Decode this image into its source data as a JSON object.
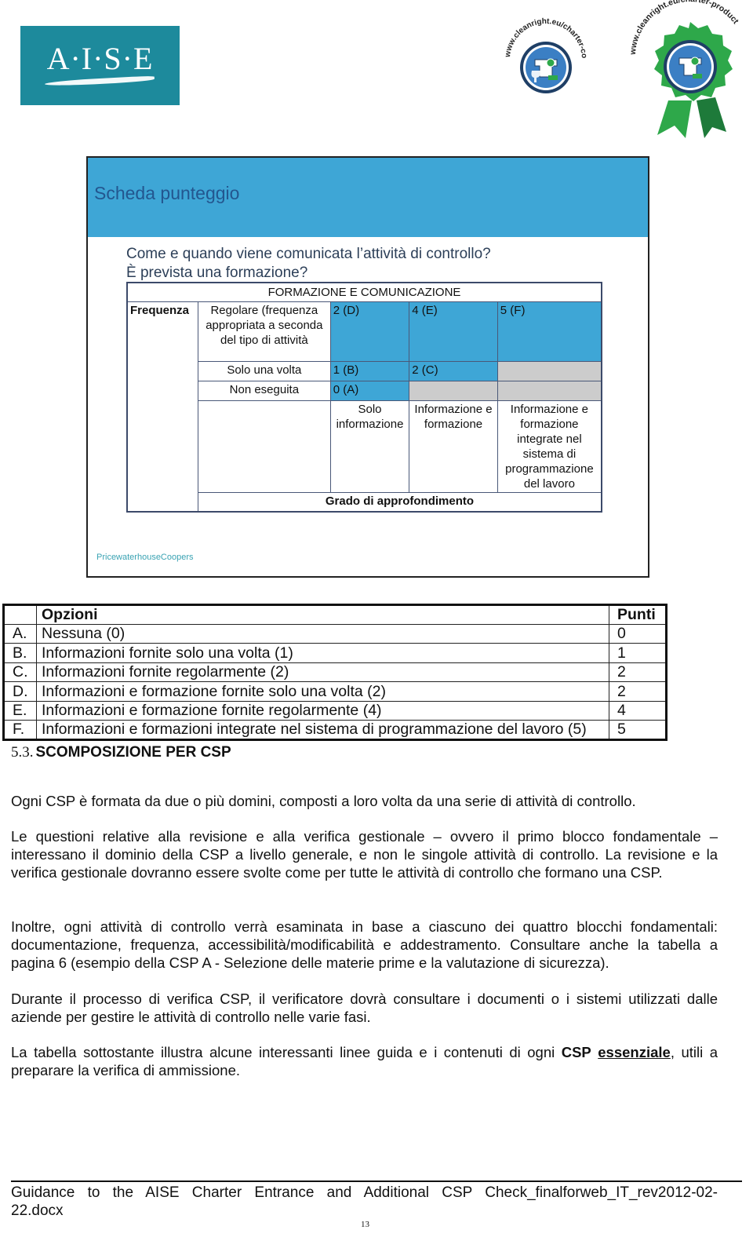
{
  "header": {
    "logo_text": "A·I·S·E",
    "badge_company_url": "www.cleanright.eu/charter-company",
    "badge_product_url": "www.cleanright.eu/charter-product",
    "colors": {
      "aise_teal": "#1d8a9c",
      "badge_blue": "#3b7fc4",
      "badge_green": "#2ea84a"
    }
  },
  "slide": {
    "title": "Scheda punteggio",
    "question_line1": "Come e quando viene comunicata l’attività di controllo?",
    "question_line2": "È prevista una formazione?",
    "footer": "PricewaterhouseCoopers",
    "colors": {
      "header_blue": "#3ea6d6",
      "cell_blue": "#3ea6d6",
      "cell_grey": "#cccccc"
    },
    "matrix": {
      "title": "FORMAZIONE E COMUNICAZIONE",
      "row_axis_label": "Frequenza",
      "rows": [
        {
          "label": "Regolare (frequenza appropriata a seconda del tipo di attività",
          "cells": [
            "2 (D)",
            "4 (E)",
            "5 (F)"
          ]
        },
        {
          "label": "Solo una volta",
          "cells": [
            "1 (B)",
            "2 (C)",
            ""
          ]
        },
        {
          "label": "Non eseguita",
          "cells": [
            "0 (A)",
            "",
            ""
          ]
        }
      ],
      "column_headers": [
        "Solo informazione",
        "Informazione e formazione",
        "Informazione e formazione integrate nel sistema di programmazione del lavoro"
      ],
      "column_axis_label": "Grado di approfondimento"
    }
  },
  "options_table": {
    "header_option": "Opzioni",
    "header_points": "Punti",
    "rows": [
      {
        "letter": "A.",
        "text": "Nessuna (0)",
        "points": "0"
      },
      {
        "letter": "B.",
        "text": "Informazioni fornite solo una volta (1)",
        "points": "1"
      },
      {
        "letter": "C.",
        "text": "Informazioni fornite regolarmente (2)",
        "points": "2"
      },
      {
        "letter": "D.",
        "text": "Informazioni e formazione fornite solo una volta (2)",
        "points": "2"
      },
      {
        "letter": "E.",
        "text": "Informazioni e formazione fornite regolarmente (4)",
        "points": "4"
      },
      {
        "letter": "F.",
        "text": "Informazioni e formazioni integrate nel sistema di programmazione del lavoro (5)",
        "points": "5"
      }
    ]
  },
  "section": {
    "number": "5.3.",
    "title": "SCOMPOSIZIONE PER CSP"
  },
  "paragraphs": {
    "p1": "Ogni CSP è formata da due o più domini, composti a loro volta da una serie di attività di controllo.",
    "p2": "Le questioni relative alla revisione e alla verifica gestionale – ovvero il primo blocco fondamentale – interessano il dominio della CSP a livello generale, e non le singole attività di controllo. La revisione e la verifica gestionale dovranno essere svolte come per tutte le attività di controllo che formano una CSP.",
    "p3": "Inoltre, ogni attività di controllo verrà esaminata in base a ciascuno dei quattro blocchi fondamentali: documentazione, frequenza, accessibilità/modificabilità e addestramento. Consultare anche la tabella a pagina 6 (esempio della CSP A - Selezione delle materie prime e la valutazione di sicurezza).",
    "p4": "Durante il processo di verifica CSP, il verificatore dovrà consultare i documenti o i sistemi utilizzati dalle aziende per gestire le attività di controllo nelle varie fasi.",
    "p5_before": "La tabella sottostante illustra alcune interessanti linee guida e i contenuti di ogni ",
    "p5_bold": "CSP",
    "p5_bold_underline": "essenziale",
    "p5_after": ", utili a preparare la verifica di ammissione."
  },
  "footer": {
    "text": "Guidance to the AISE Charter Entrance and Additional CSP Check_finalforweb_IT_rev2012-02-22.docx",
    "page_number": "13"
  }
}
